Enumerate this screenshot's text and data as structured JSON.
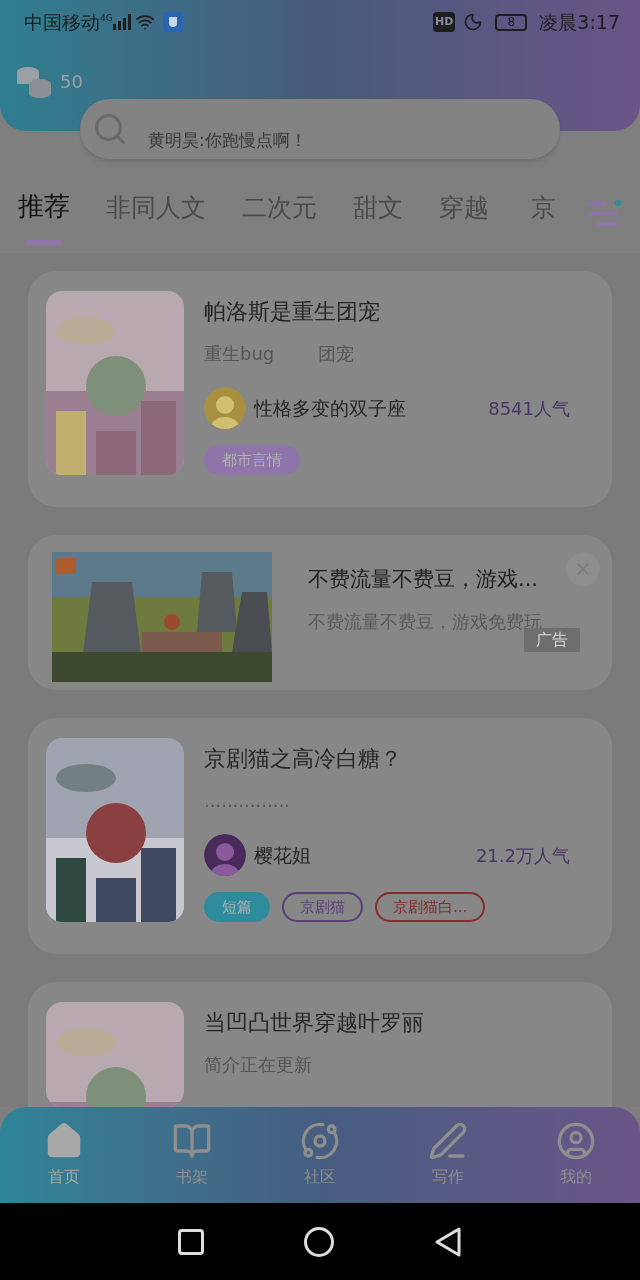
{
  "status_bar": {
    "carrier": "中国移动",
    "network": "4G",
    "hd": "HD",
    "battery": "8",
    "time": "凌晨3:17"
  },
  "header": {
    "coins": "50",
    "search_text": "黄明昊:你跑慢点啊！"
  },
  "tabs": [
    {
      "label": "推荐",
      "selected": true
    },
    {
      "label": "非同人文",
      "selected": false
    },
    {
      "label": "二次元",
      "selected": false
    },
    {
      "label": "甜文",
      "selected": false
    },
    {
      "label": "穿越",
      "selected": false
    },
    {
      "label": "京",
      "selected": false
    }
  ],
  "feed": [
    {
      "kind": "book",
      "title": "帕洛斯是重生团宠",
      "keywords": [
        "重生bug",
        "团宠"
      ],
      "author": "性格多变的双子座",
      "popularity": "8541人气",
      "tags": [
        {
          "label": "都市言情",
          "kind": "filled",
          "color": "#8e74a8"
        }
      ]
    },
    {
      "kind": "ad",
      "title": "不费流量不费豆，游戏...",
      "description": "不费流量不费豆，游戏免费玩",
      "badge": "广告"
    },
    {
      "kind": "book",
      "title": "京剧猫之高冷白糖？",
      "keywords": [
        "..............."
      ],
      "author": "樱花姐",
      "popularity": "21.2万人气",
      "tags": [
        {
          "label": "短篇",
          "kind": "filled",
          "color": "#2f8c9c"
        },
        {
          "label": "京剧猫",
          "kind": "outline",
          "color": "#5a3f7a"
        },
        {
          "label": "京剧猫白...",
          "kind": "outline",
          "color": "#8a2a2a"
        }
      ]
    },
    {
      "kind": "book",
      "title": "当凹凸世界穿越叶罗丽",
      "keywords": [
        "简介正在更新"
      ]
    }
  ],
  "bottom_nav": [
    {
      "label": "首页",
      "selected": true
    },
    {
      "label": "书架",
      "selected": false
    },
    {
      "label": "社区",
      "selected": false
    },
    {
      "label": "写作",
      "selected": false
    },
    {
      "label": "我的",
      "selected": false
    }
  ]
}
